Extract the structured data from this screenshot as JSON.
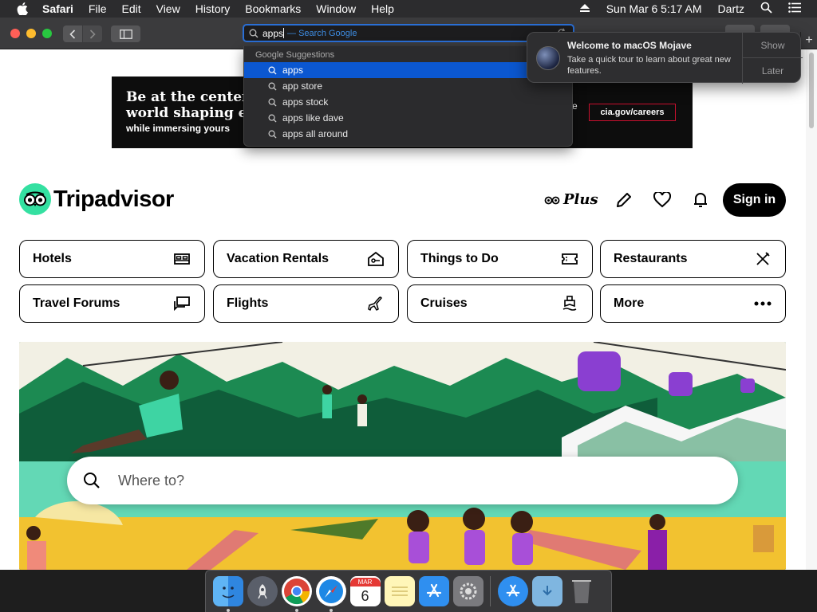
{
  "menubar": {
    "app_name": "Safari",
    "items": [
      "File",
      "Edit",
      "View",
      "History",
      "Bookmarks",
      "Window",
      "Help"
    ],
    "datetime": "Sun Mar 6  5:17 AM",
    "user": "Dartz"
  },
  "toolbar": {
    "address_typed": "apps",
    "address_hint": "— Search Google"
  },
  "suggestions": {
    "header": "Google Suggestions",
    "items": [
      "apps",
      "app store",
      "apps stock",
      "apps like dave",
      "apps all around"
    ],
    "selected_index": 0
  },
  "notification": {
    "title": "Welcome to macOS Mojave",
    "body": "Take a quick tour to learn about great new features.",
    "show_label": "Show",
    "later_label": "Later"
  },
  "ad": {
    "headline_line1": "Be at the center o",
    "headline_line2": "world shaping eve",
    "subline": "while immersing yours",
    "right_fragment": "e",
    "cta": "cia.gov/careers"
  },
  "site": {
    "brand": "Tripadvisor",
    "plus_label": "Plus",
    "signin_label": "Sign in",
    "search_placeholder": "Where to?"
  },
  "categories": [
    {
      "label": "Hotels",
      "icon": "bed-icon"
    },
    {
      "label": "Vacation Rentals",
      "icon": "house-key-icon"
    },
    {
      "label": "Things to Do",
      "icon": "ticket-icon"
    },
    {
      "label": "Restaurants",
      "icon": "fork-knife-icon"
    },
    {
      "label": "Travel Forums",
      "icon": "chat-bubbles-icon"
    },
    {
      "label": "Flights",
      "icon": "airplane-icon"
    },
    {
      "label": "Cruises",
      "icon": "ship-icon"
    },
    {
      "label": "More",
      "icon": "more-dots-icon"
    }
  ],
  "dock": {
    "apps": [
      "Finder",
      "Launchpad",
      "Chrome",
      "Safari",
      "Calendar",
      "Notes",
      "App Store",
      "System Preferences",
      "App Store Downloads",
      "Downloads",
      "Trash"
    ],
    "calendar_month": "MAR",
    "calendar_day": "6"
  },
  "colors": {
    "accent_blue": "#0b57d0",
    "brand_green": "#34e0a1",
    "ad_cta_red": "#c8102e"
  }
}
